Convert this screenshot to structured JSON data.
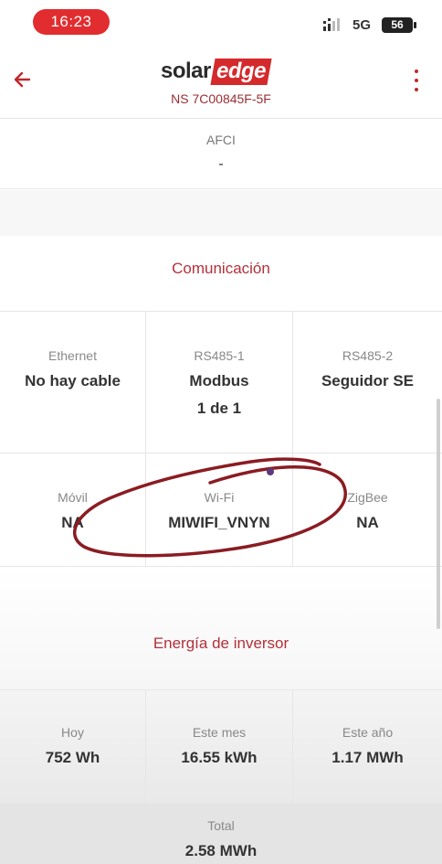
{
  "status_bar": {
    "time": "16:23",
    "network": "5G",
    "battery": "56"
  },
  "header": {
    "logo_solar": "solar",
    "logo_edge": "edge",
    "device_id": "NS 7C00845F-5F",
    "back_icon": "arrow-left-icon",
    "menu_icon": "more-vertical-icon"
  },
  "afci": {
    "label": "AFCI",
    "value": "-"
  },
  "communication": {
    "title": "Comunicación",
    "cells": [
      {
        "label": "Ethernet",
        "value": "No hay cable",
        "value2": ""
      },
      {
        "label": "RS485-1",
        "value": "Modbus",
        "value2": "1 de 1"
      },
      {
        "label": "RS485-2",
        "value": "Seguidor SE",
        "value2": ""
      },
      {
        "label": "Móvil",
        "value": "NA",
        "value2": ""
      },
      {
        "label": "Wi-Fi",
        "value": "MIWIFI_VNYN",
        "value2": ""
      },
      {
        "label": "ZigBee",
        "value": "NA",
        "value2": ""
      }
    ]
  },
  "energy": {
    "title": "Energía de inversor",
    "cells": [
      {
        "label": "Hoy",
        "value": "752 Wh"
      },
      {
        "label": "Este mes",
        "value": "16.55 kWh"
      },
      {
        "label": "Este año",
        "value": "1.17 MWh"
      },
      {
        "label": "Total",
        "value": "2.58 MWh"
      }
    ]
  },
  "colors": {
    "brand_red": "#d42a2c",
    "section_title": "#b3303a",
    "annotation": "#8a1c22"
  }
}
